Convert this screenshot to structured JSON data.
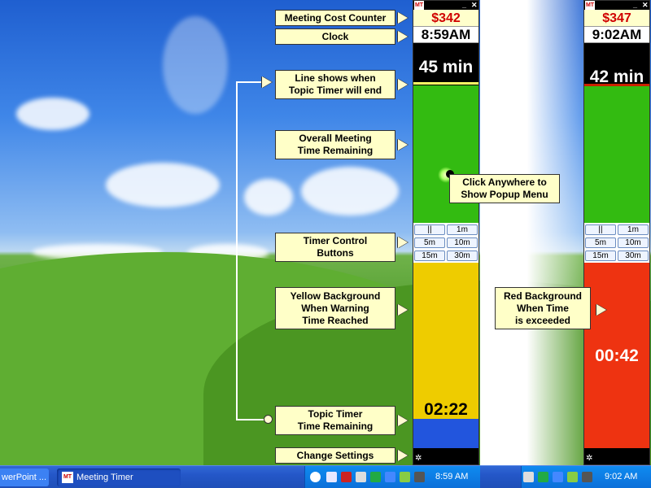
{
  "left_timer": {
    "cost": "$342",
    "clock": "8:59AM",
    "remaining": "45 min",
    "topic_remaining": "02:22"
  },
  "right_timer": {
    "cost": "$347",
    "clock": "9:02AM",
    "remaining": "42 min",
    "topic_remaining": "00:42"
  },
  "control_buttons": [
    "||",
    "1m",
    "5m",
    "10m",
    "15m",
    "30m"
  ],
  "callouts": {
    "meeting_cost_counter": "Meeting Cost Counter",
    "clock": "Clock",
    "line_shows_l1": "Line shows when",
    "line_shows_l2": "Topic Timer will end",
    "overall_l1": "Overall Meeting",
    "overall_l2": "Time Remaining",
    "click_l1": "Click Anywhere to",
    "click_l2": "Show Popup Menu",
    "control_l1": "Timer Control",
    "control_l2": "Buttons",
    "yellow_l1": "Yellow Background",
    "yellow_l2": "When Warning",
    "yellow_l3": "Time Reached",
    "red_l1": "Red Background",
    "red_l2": "When Time",
    "red_l3": "is exceeded",
    "topic_l1": "Topic Timer",
    "topic_l2": "Time Remaining",
    "change_settings": "Change Settings"
  },
  "taskbar": {
    "task_powerpoint": "werPoint ...",
    "task_meeting_timer": "Meeting Timer",
    "time_left": "8:59 AM",
    "time_right": "9:02 AM"
  },
  "colors": {
    "green": "#33bb11",
    "yellow": "#eecc00",
    "red": "#ee3311",
    "blue": "#2255dd",
    "callout_bg": "#ffffc8"
  }
}
